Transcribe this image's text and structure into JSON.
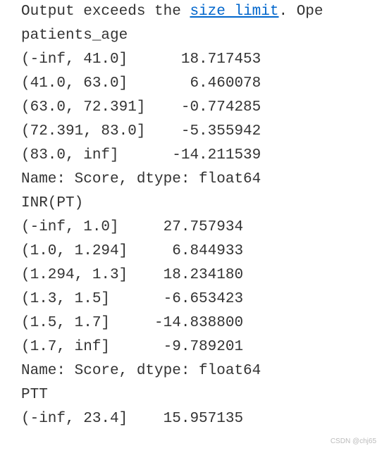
{
  "header": {
    "output_exceeds_prefix": "Output exceeds the ",
    "size_limit_link": "size limit",
    "output_exceeds_suffix": ". Ope"
  },
  "sections": [
    {
      "title": "patients_age",
      "rows": [
        {
          "bin": "(-inf, 41.0]",
          "value": "18.717453",
          "spacing": "      "
        },
        {
          "bin": "(41.0, 63.0]",
          "value": "6.460078",
          "spacing": "       "
        },
        {
          "bin": "(63.0, 72.391]",
          "value": "-0.774285",
          "spacing": "    "
        },
        {
          "bin": "(72.391, 83.0]",
          "value": "-5.355942",
          "spacing": "    "
        },
        {
          "bin": "(83.0, inf]",
          "value": "-14.211539",
          "spacing": "      "
        }
      ],
      "footer": "Name: Score, dtype: float64"
    },
    {
      "title": "INR(PT)",
      "rows": [
        {
          "bin": "(-inf, 1.0]",
          "value": "27.757934",
          "spacing": "     "
        },
        {
          "bin": "(1.0, 1.294]",
          "value": "6.844933",
          "spacing": "     "
        },
        {
          "bin": "(1.294, 1.3]",
          "value": "18.234180",
          "spacing": "    "
        },
        {
          "bin": "(1.3, 1.5]",
          "value": "-6.653423",
          "spacing": "      "
        },
        {
          "bin": "(1.5, 1.7]",
          "value": "-14.838800",
          "spacing": "     "
        },
        {
          "bin": "(1.7, inf]",
          "value": "-9.789201",
          "spacing": "      "
        }
      ],
      "footer": "Name: Score, dtype: float64"
    },
    {
      "title": "PTT",
      "rows": [
        {
          "bin": "(-inf, 23.4]",
          "value": "15.957135",
          "spacing": "    "
        }
      ],
      "footer": ""
    }
  ],
  "watermark": "CSDN @chj65"
}
